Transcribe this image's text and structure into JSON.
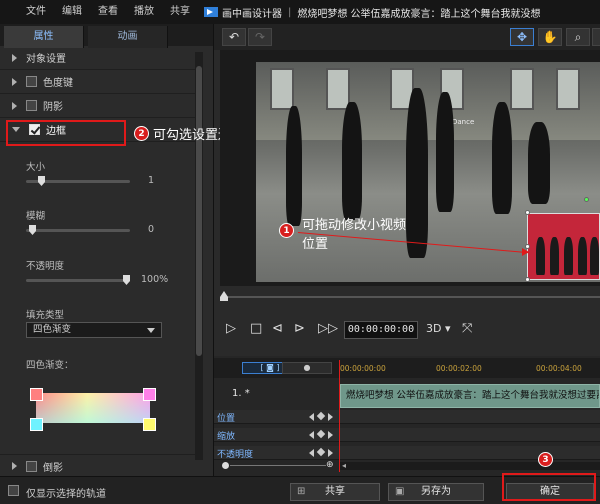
{
  "menu": [
    "文件",
    "编辑",
    "查看",
    "播放",
    "共享"
  ],
  "app_title": "画中画设计器",
  "title_sep": "|",
  "project_title": "燃烧吧梦想 公举伍嘉成放豪言：踏上这个舞台我就没想",
  "tabs": [
    "属性",
    "动画"
  ],
  "properties": {
    "object_settings": "对象设置",
    "chroma_key": "色度键",
    "shadow": "阴影",
    "border": "边框",
    "reflection": "倒影"
  },
  "border": {
    "size_label": "大小",
    "size_value": "1",
    "size_fraction": 0.12,
    "blur_label": "模糊",
    "blur_value": "0",
    "blur_fraction": 0.03,
    "opacity_label": "不透明度",
    "opacity_value": "100%",
    "opacity_fraction": 1.0,
    "fill_type_label": "填充类型",
    "fill_type_value": "四色渐变",
    "gradient_label": "四色渐变：",
    "gradient_colors": [
      "#ff8080",
      "#ff80e8",
      "#6ff2ff",
      "#fffb6f"
    ]
  },
  "annotations": {
    "a1_num": "1",
    "a1_text_line1": "可拖动修改小视频",
    "a1_text_line2": "位置",
    "a2_num": "2",
    "a2_text": "可勾选设置边框等属性",
    "a3_num": "3"
  },
  "player": {
    "timecode": "00:00:00:00",
    "mode_3d": "3D",
    "watermark": "Dance"
  },
  "timeline": {
    "ruler": [
      "00:00:00:00",
      "00:00:02:00",
      "00:00:04:00"
    ],
    "track_label": "1. *",
    "clip_title": "燃烧吧梦想 公举伍嘉成放豪言：踏上这个舞台我就没想过要离开",
    "keyframe_rows": [
      "位置",
      "缩放",
      "不透明度"
    ]
  },
  "footer": {
    "only_selected_label": "仅显示选择的轨道",
    "share": "共享",
    "save_as": "另存为",
    "ok": "确定"
  },
  "colors": {
    "accent_red": "#e01a1a",
    "accent_blue": "#3b7fd2",
    "timecode_gold": "#c9a23c"
  }
}
